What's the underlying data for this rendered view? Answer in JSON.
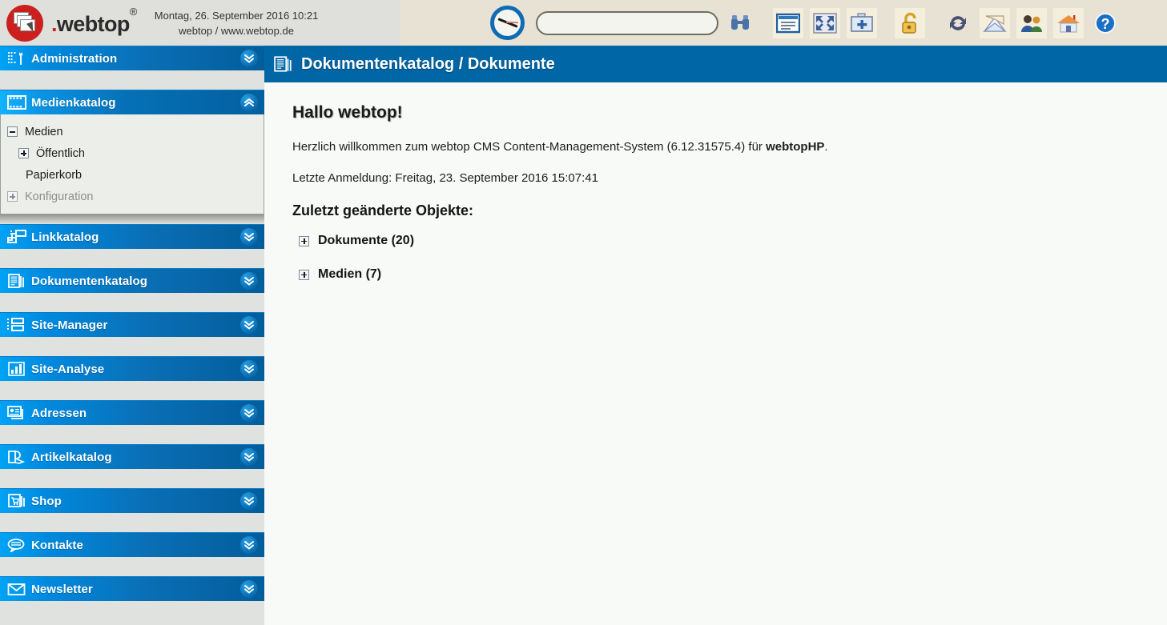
{
  "topbar": {
    "brand_dot": ".",
    "brand_name": "webtop",
    "brand_reg": "®",
    "datetime": "Montag, 26. September 2016 10:21",
    "site": "webtop / www.webtop.de",
    "search": {
      "value": "",
      "placeholder": ""
    },
    "icons": [
      {
        "name": "compass-navigate-icon",
        "label": "Navigation"
      },
      {
        "name": "binoculars-search-icon",
        "label": "Suchen"
      },
      {
        "name": "window-content-icon",
        "label": "Inhalt anzeigen"
      },
      {
        "name": "fullscreen-expand-icon",
        "label": "Vollbild"
      },
      {
        "name": "add-new-icon",
        "label": "Neu anlegen"
      },
      {
        "name": "unlock-padlock-icon",
        "label": "Freigeben"
      },
      {
        "name": "refresh-icon",
        "label": "Aktualisieren"
      },
      {
        "name": "mail-envelope-icon",
        "label": "Nachrichten"
      },
      {
        "name": "users-group-icon",
        "label": "Benutzer"
      },
      {
        "name": "home-house-icon",
        "label": "Startseite"
      },
      {
        "name": "help-question-icon",
        "label": "Hilfe"
      }
    ]
  },
  "sidebar": {
    "items": [
      {
        "label": "Administration",
        "icon": "tools-admin-icon",
        "expanded": false
      },
      {
        "label": "Medienkatalog",
        "icon": "filmstrip-media-icon",
        "expanded": true
      },
      {
        "label": "Linkkatalog",
        "icon": "link-node-icon",
        "expanded": false
      },
      {
        "label": "Dokumentenkatalog",
        "icon": "documents-icon",
        "expanded": false
      },
      {
        "label": "Site-Manager",
        "icon": "sitemap-icon",
        "expanded": false
      },
      {
        "label": "Site-Analyse",
        "icon": "bar-chart-icon",
        "expanded": false
      },
      {
        "label": "Adressen",
        "icon": "address-cards-icon",
        "expanded": false
      },
      {
        "label": "Artikelkatalog",
        "icon": "article-pages-icon",
        "expanded": false
      },
      {
        "label": "Shop",
        "icon": "shopping-cart-icon",
        "expanded": false
      },
      {
        "label": "Kontakte",
        "icon": "speech-bubbles-icon",
        "expanded": false
      },
      {
        "label": "Newsletter",
        "icon": "envelope-icon",
        "expanded": false
      }
    ],
    "media_tree": [
      {
        "label": "Medien",
        "state": "minus",
        "indent": 0,
        "disabled": false
      },
      {
        "label": "Öffentlich",
        "state": "plus",
        "indent": 1,
        "disabled": false
      },
      {
        "label": "Papierkorb",
        "state": "none",
        "indent": 2,
        "disabled": false
      },
      {
        "label": "Konfiguration",
        "state": "plus",
        "indent": 0,
        "disabled": true
      }
    ]
  },
  "main": {
    "header_title": "Dokumentenkatalog / Dokumente",
    "header_icon": "documents-icon",
    "greeting": "Hallo webtop!",
    "welcome_prefix": "Herzlich willkommen zum webtop CMS Content-Management-System (6.12.31575.4) für ",
    "welcome_bold": "webtopHP",
    "welcome_suffix": ".",
    "last_login": "Letzte Anmeldung: Freitag, 23. September 2016 15:07:41",
    "changed_heading": "Zuletzt geänderte Objekte:",
    "objects": [
      {
        "label": "Dokumente (20)"
      },
      {
        "label": "Medien (7)"
      }
    ]
  },
  "colors": {
    "accent_blue": "#0066a6",
    "bar_light": "#00a2f5",
    "bar_dark": "#035d9b",
    "topbar_beige": "#e8e2d5",
    "topbar_gray": "#dfe0db",
    "sidebar_gap": "#dfe2de",
    "content_bg": "#f7faf7",
    "logo_red": "#cc2020"
  }
}
